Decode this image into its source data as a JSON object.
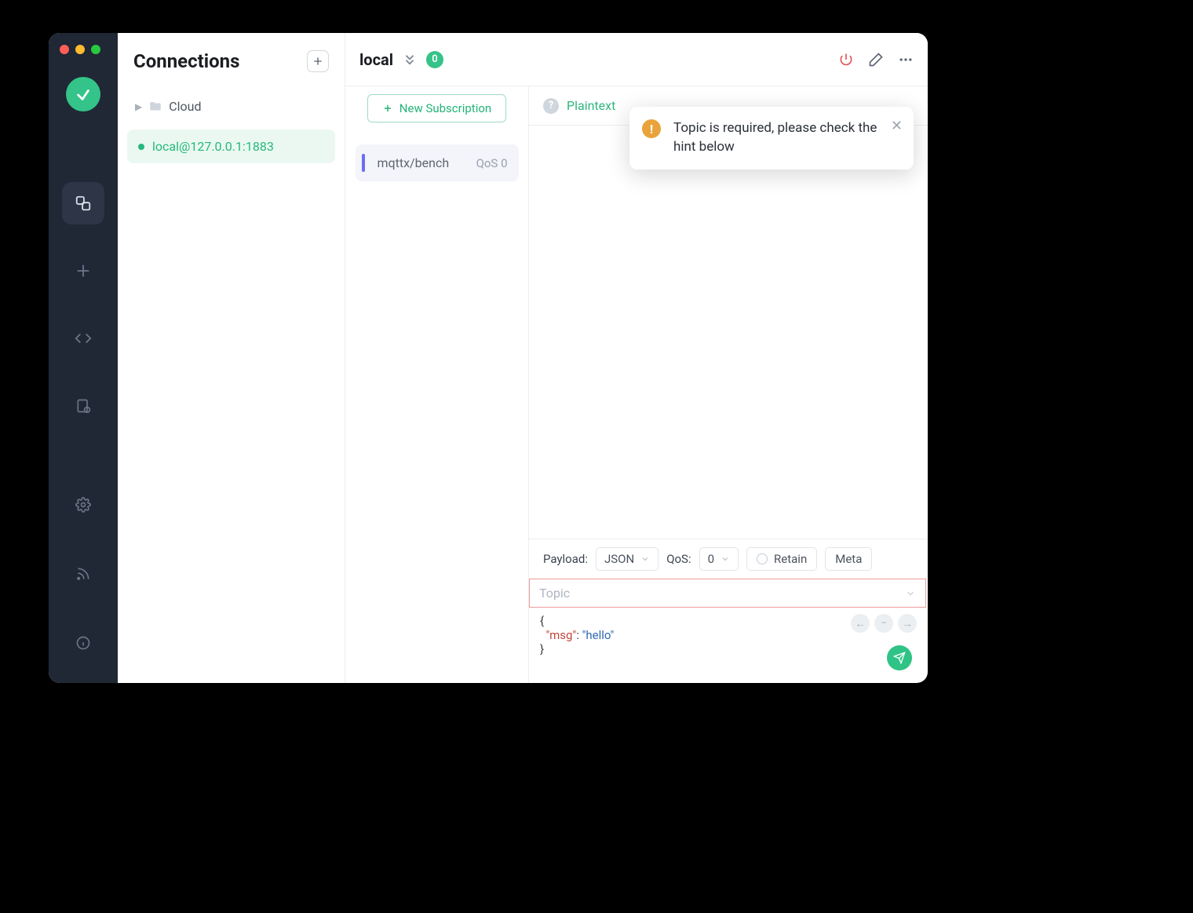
{
  "sidebar": {
    "title": "Connections",
    "folder": "Cloud",
    "connection": "local@127.0.0.1:1883"
  },
  "header": {
    "name": "local",
    "count": "0"
  },
  "subs": {
    "new_label": "New Subscription",
    "items": [
      {
        "name": "mqttx/bench",
        "qos": "QoS 0"
      }
    ]
  },
  "filter": {
    "mode": "Plaintext"
  },
  "publish": {
    "payload_label": "Payload:",
    "payload_type": "JSON",
    "qos_label": "QoS:",
    "qos_value": "0",
    "retain_label": "Retain",
    "meta_label": "Meta",
    "topic_placeholder": "Topic",
    "body_open": "{",
    "body_key": "\"msg\"",
    "body_colon": ": ",
    "body_val": "\"hello\"",
    "body_close": "}"
  },
  "toast": {
    "message": "Topic is required, please check the hint below"
  }
}
